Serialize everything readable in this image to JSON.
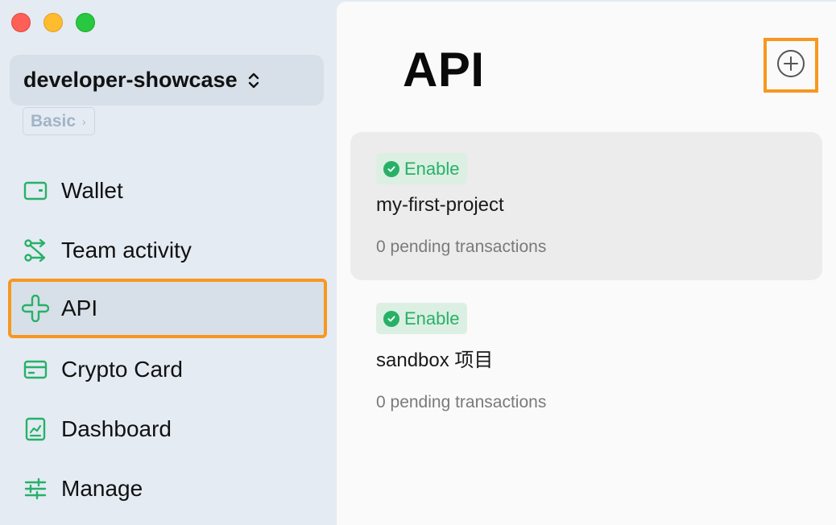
{
  "window": {
    "controls": [
      "close",
      "minimize",
      "maximize"
    ]
  },
  "sidebar": {
    "workspace_name": "developer-showcase",
    "workspace_switch_icon": "chevron-up-down-icon",
    "plan_label": "Basic",
    "plan_arrow": "›",
    "items": [
      {
        "label": "Wallet",
        "icon": "wallet-icon"
      },
      {
        "label": "Team activity",
        "icon": "flow-icon"
      },
      {
        "label": "API",
        "icon": "api-icon",
        "active": true
      },
      {
        "label": "Crypto Card",
        "icon": "card-icon"
      },
      {
        "label": "Dashboard",
        "icon": "chart-doc-icon"
      },
      {
        "label": "Manage",
        "icon": "sliders-icon"
      }
    ]
  },
  "main": {
    "title": "API",
    "add_icon": "plus-circle-icon",
    "projects": [
      {
        "status": "Enable",
        "name": "my-first-project",
        "pending": "0 pending transactions"
      },
      {
        "status": "Enable",
        "name": "sandbox 项目",
        "pending": "0 pending transactions"
      }
    ]
  },
  "colors": {
    "accent_green": "#27b167",
    "highlight_orange": "#f7971f",
    "sidebar_bg": "#e4ebf3",
    "main_bg": "#fafafa"
  }
}
